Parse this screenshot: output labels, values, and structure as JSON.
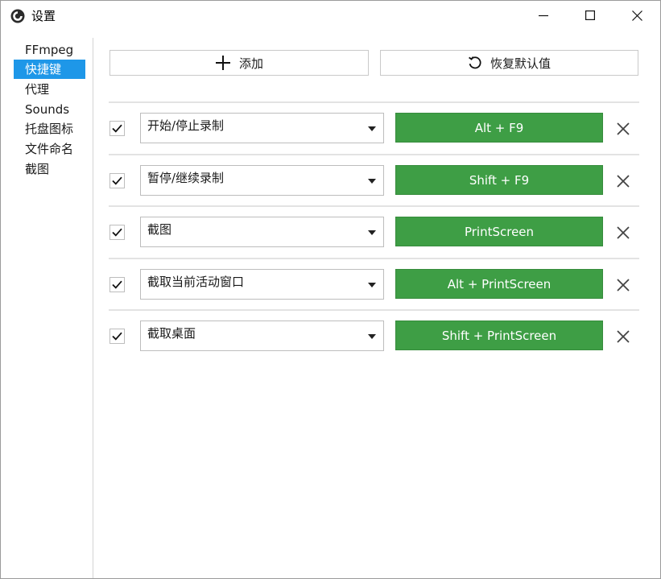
{
  "window": {
    "title": "设置"
  },
  "sidebar": {
    "items": [
      {
        "label": "FFmpeg",
        "active": false
      },
      {
        "label": "快捷键",
        "active": true
      },
      {
        "label": "代理",
        "active": false
      },
      {
        "label": "Sounds",
        "active": false
      },
      {
        "label": "托盘图标",
        "active": false
      },
      {
        "label": "文件命名",
        "active": false
      },
      {
        "label": "截图",
        "active": false
      }
    ]
  },
  "toolbar": {
    "add_label": "添加",
    "add_icon": "plus-icon",
    "reset_label": "恢复默认值",
    "reset_icon": "undo-icon"
  },
  "hotkeys": [
    {
      "enabled": true,
      "action": "开始/停止录制",
      "key": "Alt + F9"
    },
    {
      "enabled": true,
      "action": "暂停/继续录制",
      "key": "Shift + F9"
    },
    {
      "enabled": true,
      "action": "截图",
      "key": "PrintScreen"
    },
    {
      "enabled": true,
      "action": "截取当前活动窗口",
      "key": "Alt + PrintScreen"
    },
    {
      "enabled": true,
      "action": "截取桌面",
      "key": "Shift + PrintScreen"
    }
  ],
  "colors": {
    "accent": "#1e97e8",
    "hotkey_button": "#3e9e45"
  }
}
